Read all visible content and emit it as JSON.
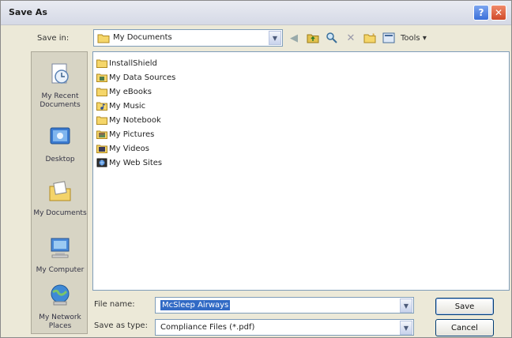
{
  "window": {
    "title": "Save As",
    "help_label": "?",
    "close_label": "✕"
  },
  "save_in": {
    "label": "Save in:",
    "value": "My Documents",
    "icon": "folder-icon"
  },
  "toolbar": {
    "tools_label": "Tools",
    "icons": [
      "back-icon",
      "up-folder-icon",
      "search-web-icon",
      "delete-icon",
      "new-folder-icon",
      "views-icon"
    ]
  },
  "places": [
    {
      "label": "My Recent Documents",
      "icon": "recent-documents-icon"
    },
    {
      "label": "Desktop",
      "icon": "desktop-icon"
    },
    {
      "label": "My Documents",
      "icon": "my-documents-icon"
    },
    {
      "label": "My Computer",
      "icon": "my-computer-icon"
    },
    {
      "label": "My Network Places",
      "icon": "network-places-icon"
    }
  ],
  "files": [
    {
      "name": "InstallShield",
      "icon": "folder-icon"
    },
    {
      "name": "My Data Sources",
      "icon": "data-sources-icon"
    },
    {
      "name": "My eBooks",
      "icon": "folder-icon"
    },
    {
      "name": "My Music",
      "icon": "music-folder-icon"
    },
    {
      "name": "My Notebook",
      "icon": "folder-icon"
    },
    {
      "name": "My Pictures",
      "icon": "pictures-folder-icon"
    },
    {
      "name": "My Videos",
      "icon": "videos-folder-icon"
    },
    {
      "name": "My Web Sites",
      "icon": "web-sites-icon"
    }
  ],
  "file_name": {
    "label": "File name:",
    "value": "McSleep Airways"
  },
  "save_as_type": {
    "label": "Save as type:",
    "value": "Compliance Files (*.pdf)"
  },
  "buttons": {
    "save": "Save",
    "cancel": "Cancel"
  }
}
